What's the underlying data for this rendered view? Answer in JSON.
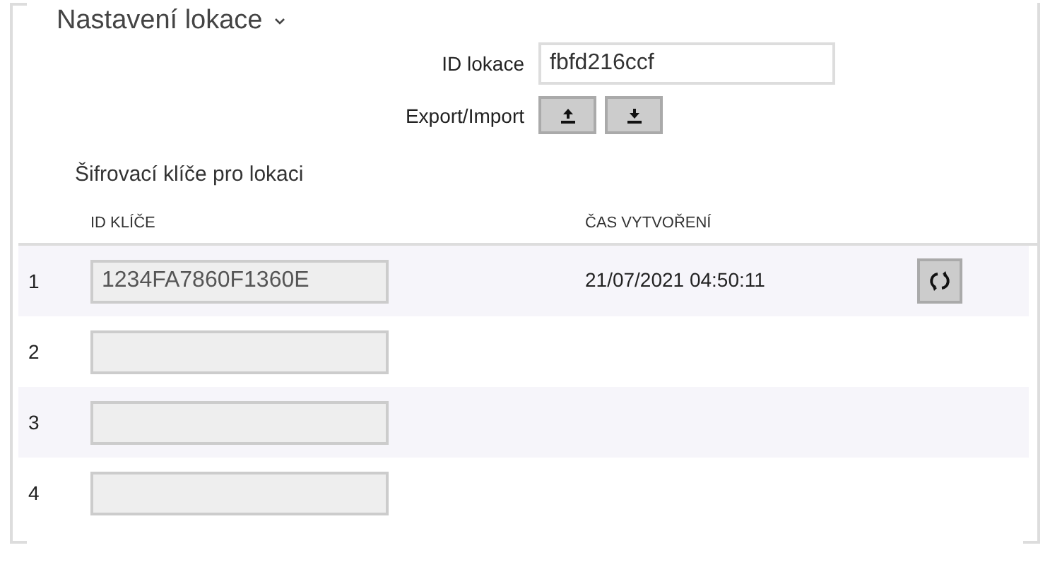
{
  "section": {
    "title": "Nastavení lokace",
    "expanded": true
  },
  "location_id": {
    "label": "ID lokace",
    "value": "fbfd216ccf"
  },
  "export_import": {
    "label": "Export/Import"
  },
  "keys": {
    "title": "Šifrovací klíče pro lokaci",
    "columns": [
      "ID KLÍČE",
      "ČAS VYTVOŘENÍ"
    ],
    "rows": [
      {
        "number": "1",
        "key_id": "1234FA7860F1360E",
        "created": "21/07/2021 04:50:11",
        "refresh_button": true
      },
      {
        "number": "2",
        "refresh_button": false
      },
      {
        "number": "3",
        "refresh_button": false
      },
      {
        "number": "4",
        "refresh_button": false
      }
    ]
  }
}
